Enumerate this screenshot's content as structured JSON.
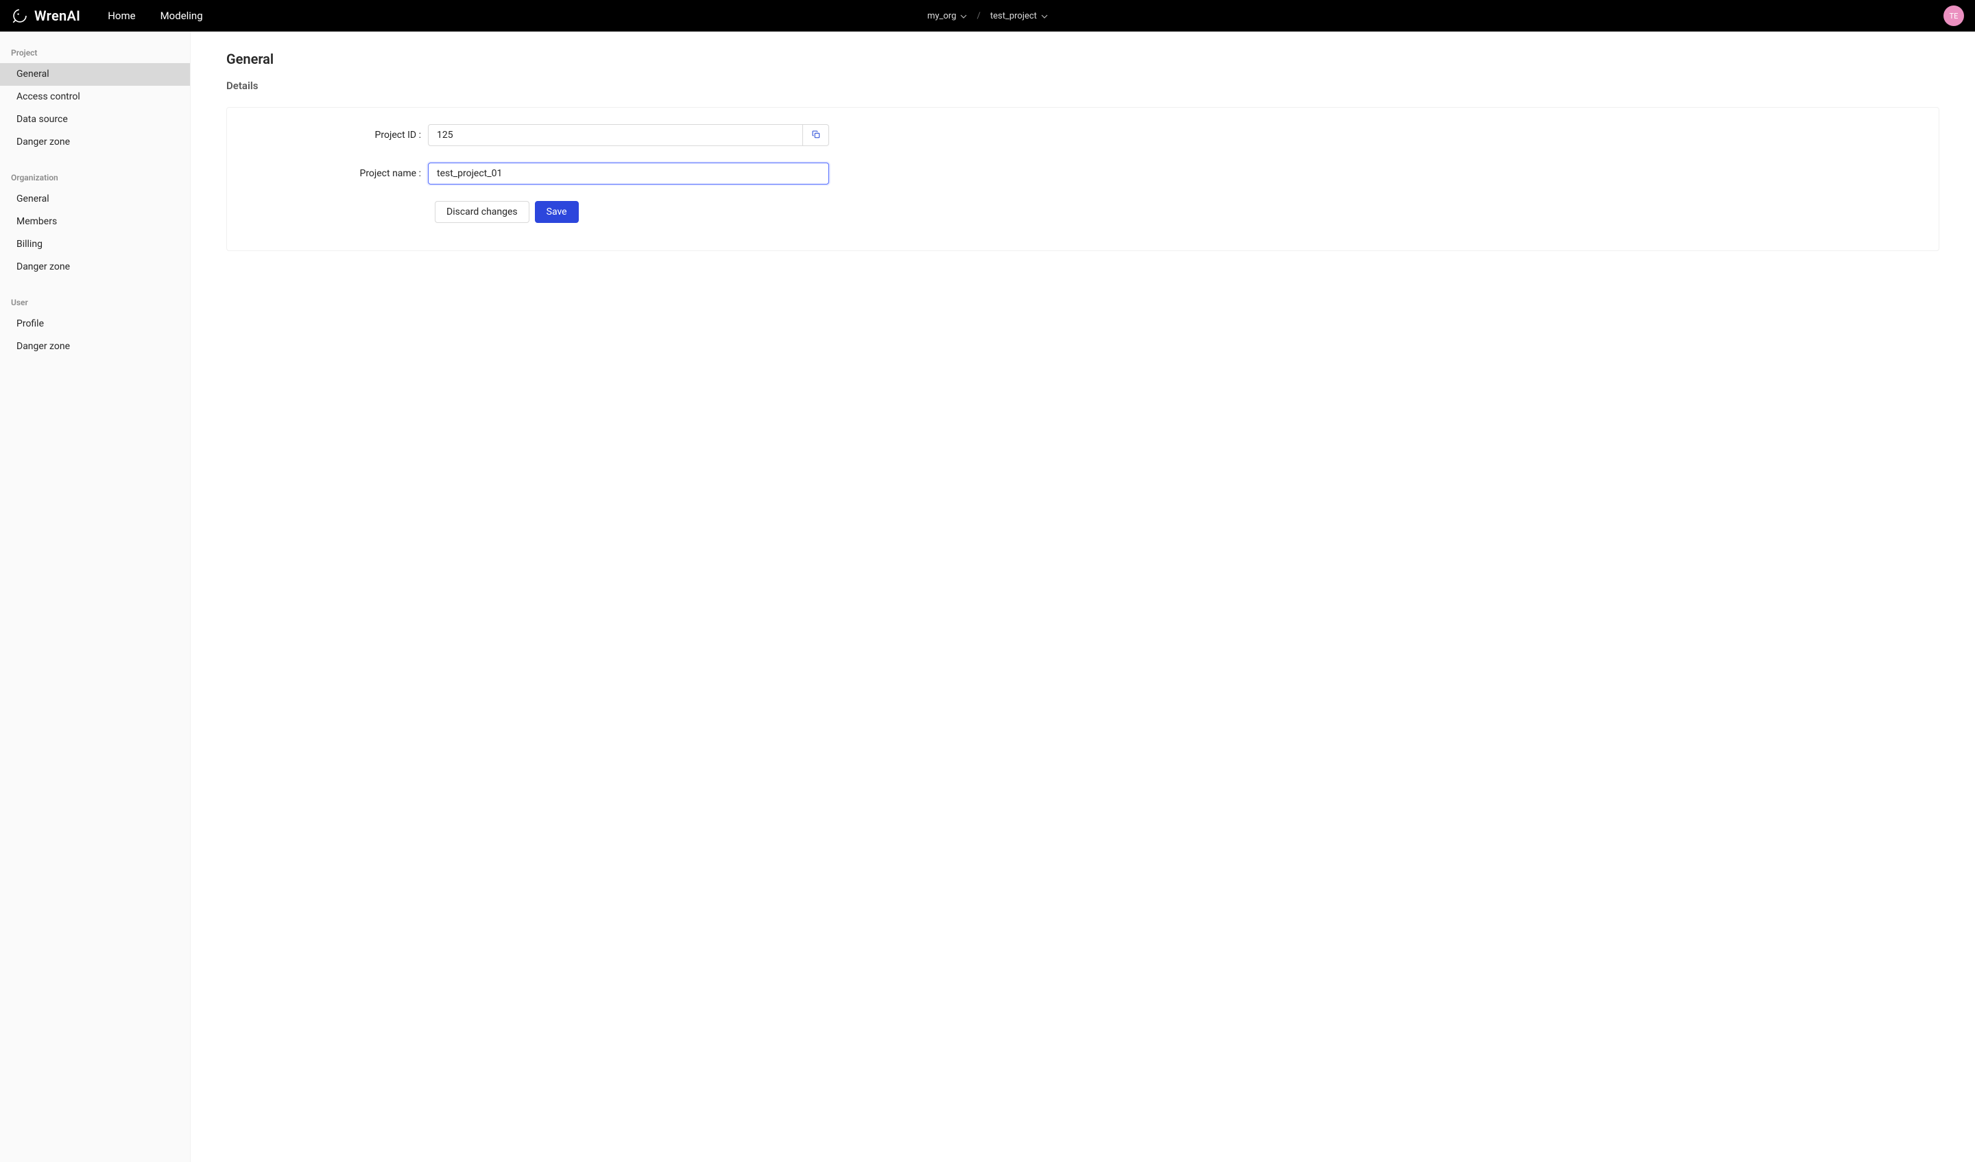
{
  "header": {
    "brand": "WrenAI",
    "nav": {
      "home": "Home",
      "modeling": "Modeling"
    },
    "breadcrumb": {
      "org": "my_org",
      "project": "test_project",
      "separator": "/"
    },
    "avatar_initials": "TE"
  },
  "sidebar": {
    "sections": [
      {
        "title": "Project",
        "items": [
          {
            "label": "General",
            "active": true
          },
          {
            "label": "Access control",
            "active": false
          },
          {
            "label": "Data source",
            "active": false
          },
          {
            "label": "Danger zone",
            "active": false
          }
        ]
      },
      {
        "title": "Organization",
        "items": [
          {
            "label": "General",
            "active": false
          },
          {
            "label": "Members",
            "active": false
          },
          {
            "label": "Billing",
            "active": false
          },
          {
            "label": "Danger zone",
            "active": false
          }
        ]
      },
      {
        "title": "User",
        "items": [
          {
            "label": "Profile",
            "active": false
          },
          {
            "label": "Danger zone",
            "active": false
          }
        ]
      }
    ]
  },
  "main": {
    "page_title": "General",
    "section_title": "Details",
    "form": {
      "project_id": {
        "label": "Project ID",
        "value": "125"
      },
      "project_name": {
        "label": "Project name",
        "value": "test_project_01"
      },
      "actions": {
        "discard": "Discard changes",
        "save": "Save"
      }
    }
  }
}
